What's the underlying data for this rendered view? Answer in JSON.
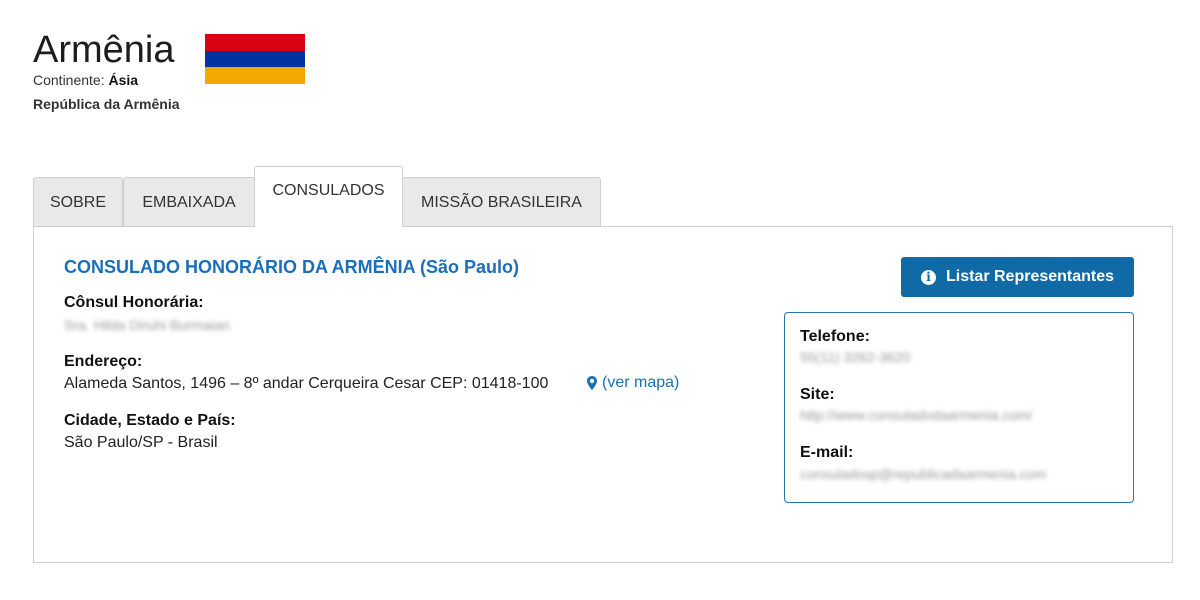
{
  "header": {
    "country_name": "Armênia",
    "continent_label": "Continente:",
    "continent_value": "Ásia",
    "official_name": "República da Armênia",
    "flag_colors": [
      "#D90012",
      "#0033A0",
      "#F2A800"
    ]
  },
  "tabs": [
    {
      "label": "SOBRE",
      "active": false
    },
    {
      "label": "EMBAIXADA",
      "active": false
    },
    {
      "label": "CONSULADOS",
      "active": true
    },
    {
      "label": "MISSÃO BRASILEIRA",
      "active": false
    }
  ],
  "consulate": {
    "title": "CONSULADO HONORÁRIO DA ARMÊNIA (São Paulo)",
    "consul_label": "Cônsul Honorária:",
    "consul_value": "Sra. Hilda Diruhi Burmaian",
    "address_label": "Endereço:",
    "address_value": "Alameda Santos, 1496 – 8º andar Cerqueira Cesar CEP: 01418-100",
    "map_link": "(ver mapa)",
    "city_label": "Cidade, Estado e País:",
    "city_value": "São Paulo/SP - Brasil",
    "list_button": "Listar Representantes"
  },
  "contact": {
    "phone_label": "Telefone:",
    "phone_value": "55(11) 3262-3620",
    "site_label": "Site:",
    "site_value": "http://www.consuladodaarmenia.com/",
    "email_label": "E-mail:",
    "email_value": "consuladosp@republicadaarmenia.com"
  },
  "colors": {
    "accent": "#1a6fb8",
    "button": "#0f6aa6"
  },
  "icons": [
    "info-icon",
    "map-marker-icon"
  ]
}
